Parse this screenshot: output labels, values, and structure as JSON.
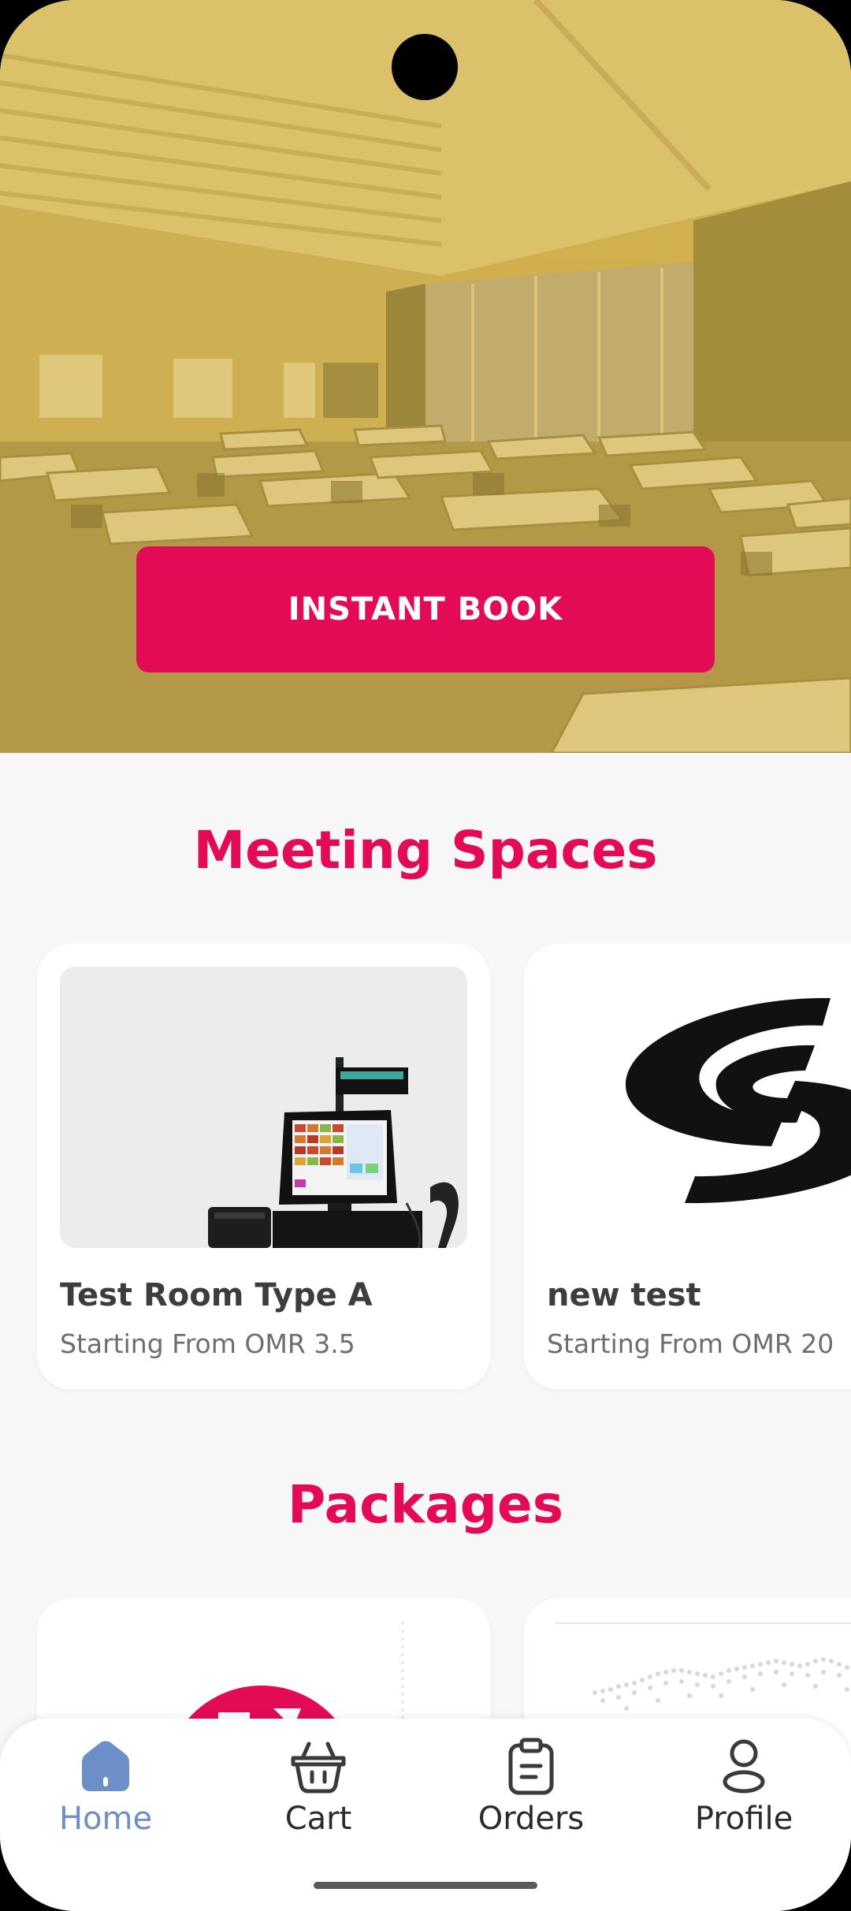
{
  "hero": {
    "button_label": "INSTANT BOOK"
  },
  "sections": {
    "meeting_spaces_title": "Meeting Spaces",
    "packages_title": "Packages"
  },
  "meeting_spaces": [
    {
      "title": "Test Room Type A",
      "subtitle": "Starting From OMR 3.5"
    },
    {
      "title": "new test",
      "subtitle": "Starting From OMR 20"
    }
  ],
  "bottom_nav": {
    "items": [
      {
        "label": "Home",
        "icon": "home-icon",
        "active": true
      },
      {
        "label": "Cart",
        "icon": "basket-icon",
        "active": false
      },
      {
        "label": "Orders",
        "icon": "clipboard-icon",
        "active": false
      },
      {
        "label": "Profile",
        "icon": "user-icon",
        "active": false
      }
    ]
  },
  "colors": {
    "accent": "#e30a56",
    "active_nav": "#6d8fc7",
    "background": "#f7f7f7"
  }
}
